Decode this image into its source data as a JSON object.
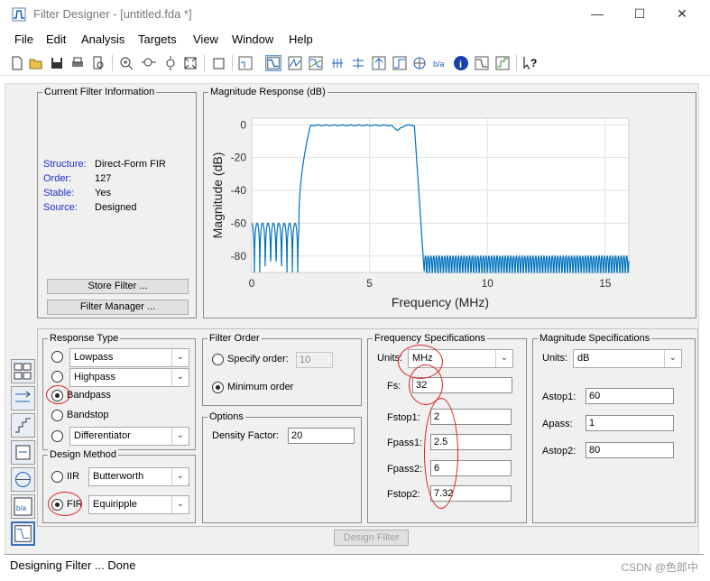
{
  "window": {
    "title": "Filter Designer - [untitled.fda *]"
  },
  "menu": [
    "File",
    "Edit",
    "Analysis",
    "Targets",
    "View",
    "Window",
    "Help"
  ],
  "current_filter": {
    "title": "Current Filter Information",
    "rows": [
      {
        "key": "Structure:",
        "value": "Direct-Form FIR"
      },
      {
        "key": "Order:",
        "value": "127"
      },
      {
        "key": "Stable:",
        "value": "Yes"
      },
      {
        "key": "Source:",
        "value": "Designed"
      }
    ],
    "store_btn": "Store Filter ...",
    "manager_btn": "Filter Manager ..."
  },
  "magnitude_panel": {
    "title": "Magnitude Response (dB)"
  },
  "chart_data": {
    "type": "line",
    "xlabel": "Frequency (MHz)",
    "ylabel": "Magnitude (dB)",
    "xlim": [
      0,
      16
    ],
    "ylim": [
      -90,
      4
    ],
    "xticks": [
      "0",
      "5",
      "10",
      "15"
    ],
    "yticks": [
      "0",
      "-20",
      "-40",
      "-60",
      "-80"
    ],
    "x_tick_values": [
      0,
      5,
      10,
      15
    ],
    "y_tick_values": [
      0,
      -20,
      -40,
      -60,
      -80
    ],
    "grid": true,
    "bands": {
      "stop1_max": 2,
      "pass_start": 2.5,
      "pass_end": 6.0,
      "stop2_start": 7.32,
      "end": 16
    },
    "levels": {
      "stop1_peak_db": -60,
      "pass_db": 0,
      "stop2_peak_db": -80,
      "floor_db": -90
    }
  },
  "response_type": {
    "title": "Response Type",
    "options": [
      "Lowpass",
      "Highpass",
      "Bandpass",
      "Bandstop",
      "Differentiator"
    ],
    "selected": "Bandpass"
  },
  "design_method": {
    "title": "Design Method",
    "iir_label": "IIR",
    "iir_value": "Butterworth",
    "fir_label": "FIR",
    "fir_value": "Equiripple",
    "selected": "FIR"
  },
  "filter_order": {
    "title": "Filter Order",
    "specify_label": "Specify order:",
    "specify_value": "10",
    "minimum_label": "Minimum order",
    "selected": "Minimum order"
  },
  "options": {
    "title": "Options",
    "density_label": "Density Factor:",
    "density_value": "20"
  },
  "freq_specs": {
    "title": "Frequency Specifications",
    "units_label": "Units:",
    "units_value": "MHz",
    "fields": [
      {
        "label": "Fs:",
        "value": "32"
      },
      {
        "label": "Fstop1:",
        "value": "2"
      },
      {
        "label": "Fpass1:",
        "value": "2.5"
      },
      {
        "label": "Fpass2:",
        "value": "6"
      },
      {
        "label": "Fstop2:",
        "value": "7.32"
      }
    ]
  },
  "mag_specs": {
    "title": "Magnitude Specifications",
    "units_label": "Units:",
    "units_value": "dB",
    "fields": [
      {
        "label": "Astop1:",
        "value": "60"
      },
      {
        "label": "Apass:",
        "value": "1"
      },
      {
        "label": "Astop2:",
        "value": "80"
      }
    ]
  },
  "design_button": "Design Filter",
  "status": "Designing Filter ... Done",
  "watermark": "CSDN @色郎中",
  "colors": {
    "curve": "#0072bd",
    "annotation": "#e02020",
    "label_blue": "#1a30c8"
  }
}
